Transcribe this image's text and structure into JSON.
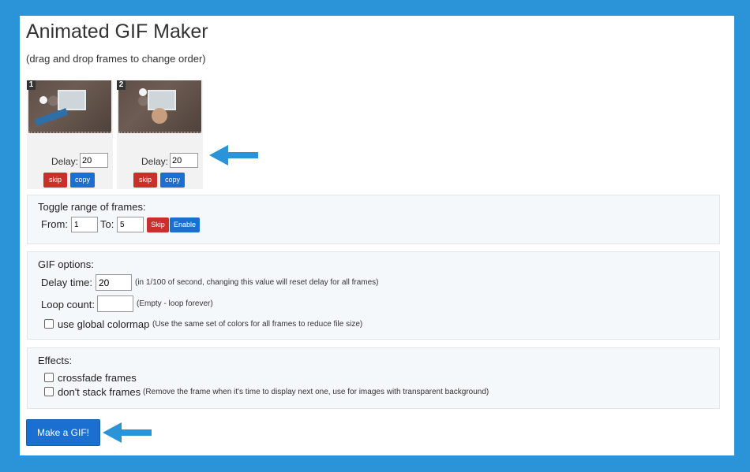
{
  "app": {
    "title": "Animated GIF Maker",
    "subtitle": "(drag and drop frames to change order)"
  },
  "frames": [
    {
      "number": "1",
      "delay_label": "Delay:",
      "delay_value": "20",
      "skip_label": "skip",
      "copy_label": "copy"
    },
    {
      "number": "2",
      "delay_label": "Delay:",
      "delay_value": "20",
      "skip_label": "skip",
      "copy_label": "copy"
    }
  ],
  "toggle_range": {
    "title": "Toggle range of frames:",
    "from_label": "From:",
    "from_value": "1",
    "to_label": "To:",
    "to_value": "5",
    "skip_label": "Skip",
    "enable_label": "Enable"
  },
  "gif_options": {
    "title": "GIF options:",
    "delay_label": "Delay time:",
    "delay_value": "20",
    "delay_note": "(in 1/100 of second, changing this value will reset delay for all frames)",
    "loop_label": "Loop count:",
    "loop_value": "",
    "loop_note": "(Empty - loop forever)",
    "colormap_label": "use global colormap",
    "colormap_note": "(Use the same set of colors for all frames to reduce file size)",
    "colormap_checked": false
  },
  "effects": {
    "title": "Effects:",
    "crossfade_label": "crossfade frames",
    "crossfade_checked": false,
    "nostack_label": "don't stack frames",
    "nostack_note": "(Remove the frame when it's time to display next one, use for images with transparent background)",
    "nostack_checked": false
  },
  "make_button": "Make a GIF!",
  "colors": {
    "background": "#2b93d8",
    "arrow": "#2b93d8",
    "skip_red": "#c9302c",
    "primary_blue": "#1a6fd0"
  },
  "icons": [
    "arrow-left-icon",
    "arrow-left-icon"
  ]
}
